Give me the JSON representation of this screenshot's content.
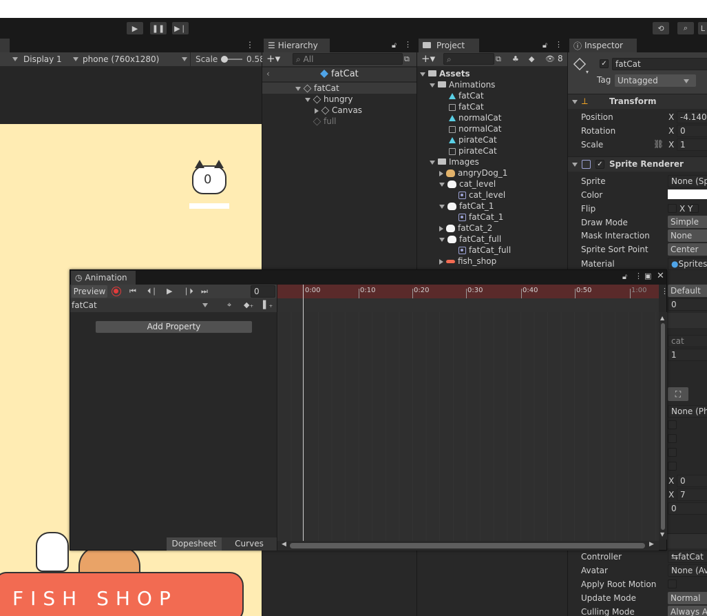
{
  "toolbar": {
    "play_icon": "play-icon",
    "pause_icon": "pause-icon",
    "step_icon": "step-icon",
    "history_icon": "history-icon",
    "search_icon": "search-icon",
    "layers_label": "L"
  },
  "game_view": {
    "display": "Display 1",
    "resolution": "phone (760x1280)",
    "scale_label": "Scale",
    "scale_value": "0.58",
    "score_counter": "0",
    "shop_sign": "FISH  SHOP",
    "bg_color": "#ffecb3"
  },
  "hierarchy": {
    "tab": "Hierarchy",
    "search_placeholder": "All",
    "breadcrumb": "fatCat",
    "items": [
      {
        "label": "fatCat"
      },
      {
        "label": "hungry"
      },
      {
        "label": "Canvas"
      },
      {
        "label": "full"
      }
    ]
  },
  "project": {
    "tab": "Project",
    "hidden_count": "8",
    "tree": [
      {
        "label": "Assets"
      },
      {
        "label": "Animations"
      },
      {
        "label": "fatCat"
      },
      {
        "label": "fatCat"
      },
      {
        "label": "normalCat"
      },
      {
        "label": "normalCat"
      },
      {
        "label": "pirateCat"
      },
      {
        "label": "pirateCat"
      },
      {
        "label": "Images"
      },
      {
        "label": "angryDog_1"
      },
      {
        "label": "cat_level"
      },
      {
        "label": "cat_level"
      },
      {
        "label": "fatCat_1"
      },
      {
        "label": "fatCat_1"
      },
      {
        "label": "fatCat_2"
      },
      {
        "label": "fatCat_full"
      },
      {
        "label": "fatCat_full"
      },
      {
        "label": "fish_shop"
      }
    ]
  },
  "inspector": {
    "tab": "Inspector",
    "object_name": "fatCat",
    "tag_label": "Tag",
    "tag_value": "Untagged",
    "transform": {
      "title": "Transform",
      "position_label": "Position",
      "position_x": "-4.140",
      "rotation_label": "Rotation",
      "rotation_x": "0",
      "scale_label": "Scale",
      "scale_x": "1",
      "x_label": "X"
    },
    "sprite_renderer": {
      "title": "Sprite Renderer",
      "rows": [
        {
          "label": "Sprite",
          "value": "None (Spr"
        },
        {
          "label": "Color",
          "value": ""
        },
        {
          "label": "Flip",
          "value": "X  Y"
        },
        {
          "label": "Draw Mode",
          "value": "Simple"
        },
        {
          "label": "Mask Interaction",
          "value": "None"
        },
        {
          "label": "Sprite Sort Point",
          "value": "Center"
        },
        {
          "label": "Material",
          "value": "Sprites-"
        }
      ]
    },
    "hidden_values": {
      "sorting_layer": "Default",
      "order": "0",
      "sprite_ref": "cat",
      "value1": "1",
      "physics": "None (Phy",
      "x0_label": "X",
      "x0": "0",
      "x1_label": "X",
      "x1": "7",
      "z": "0"
    },
    "animator": {
      "rows": [
        {
          "label": "Controller",
          "value": "fatCat"
        },
        {
          "label": "Avatar",
          "value": "None (Ava"
        },
        {
          "label": "Apply Root Motion",
          "value": ""
        },
        {
          "label": "Update Mode",
          "value": "Normal"
        },
        {
          "label": "Culling Mode",
          "value": "Always A"
        }
      ]
    }
  },
  "animation": {
    "tab": "Animation",
    "preview_label": "Preview",
    "frame": "0",
    "clip": "fatCat",
    "add_property": "Add Property",
    "dopesheet": "Dopesheet",
    "curves": "Curves",
    "timeline_ticks": [
      "0:00",
      "0:10",
      "0:20",
      "0:30",
      "0:40",
      "0:50",
      "1:00"
    ],
    "record_color": "#e23b3b",
    "timeline_header_color": "#5a2a2a"
  }
}
